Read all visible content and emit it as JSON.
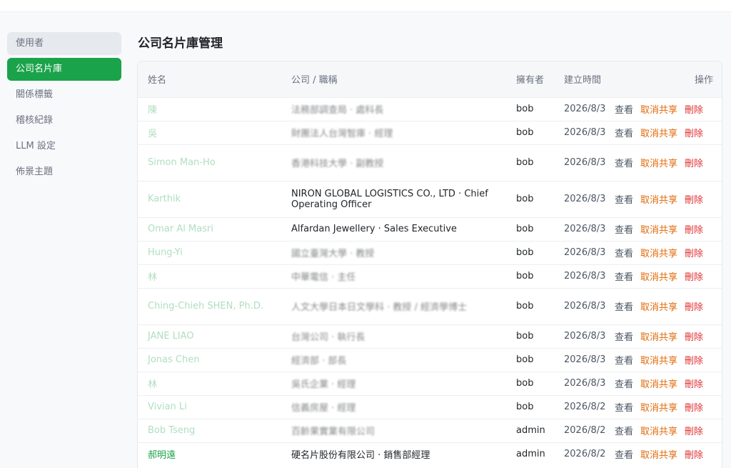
{
  "sidebar": {
    "items": [
      {
        "label": "使用者",
        "state": "hover"
      },
      {
        "label": "公司名片庫",
        "state": "active"
      },
      {
        "label": "關係標籤",
        "state": ""
      },
      {
        "label": "稽核紀錄",
        "state": ""
      },
      {
        "label": "LLM 設定",
        "state": ""
      },
      {
        "label": "佈景主題",
        "state": ""
      }
    ]
  },
  "page": {
    "title": "公司名片庫管理"
  },
  "table": {
    "headers": {
      "name": "姓名",
      "company": "公司 / 職稱",
      "owner": "擁有者",
      "created": "建立時間",
      "actions": "操作"
    },
    "actions": {
      "view": "查看",
      "unshare": "取消共享",
      "delete": "刪除"
    },
    "rows": [
      {
        "name": "陳",
        "company": "法務部調查局 · 處科長",
        "owner": "bob",
        "created": "2026/8/3"
      },
      {
        "name": "吳",
        "company": "財團法人台灣智庫 · 經理",
        "owner": "bob",
        "created": "2026/8/3"
      },
      {
        "name": "Simon Man-Ho",
        "company": "香港科技大學 · 副教授",
        "owner": "bob",
        "created": "2026/8/3"
      },
      {
        "name": "Karthik",
        "company": "NIRON GLOBAL LOGISTICS CO., LTD · Chief Operating Officer",
        "owner": "bob",
        "created": "2026/8/3"
      },
      {
        "name": "Omar Al Masri",
        "company": "Alfardan Jewellery · Sales Executive",
        "owner": "bob",
        "created": "2026/8/3"
      },
      {
        "name": "Hung-Yi",
        "company": "國立臺灣大學 · 教授",
        "owner": "bob",
        "created": "2026/8/3"
      },
      {
        "name": "林",
        "company": "中華電信 · 主任",
        "owner": "bob",
        "created": "2026/8/3"
      },
      {
        "name": "Ching-Chieh SHEN, Ph.D.",
        "company": "人文大學日本日文學科 · 教授 / 經濟學博士",
        "owner": "bob",
        "created": "2026/8/3"
      },
      {
        "name": "JANE LIAO",
        "company": "台灣公司 · 執行長",
        "owner": "bob",
        "created": "2026/8/3"
      },
      {
        "name": "Jonas Chen",
        "company": "經濟部 · 部長",
        "owner": "bob",
        "created": "2026/8/3"
      },
      {
        "name": "林",
        "company": "吳氏企業 · 經理",
        "owner": "bob",
        "created": "2026/8/3"
      },
      {
        "name": "Vivian Li",
        "company": "信義房屋 · 經理",
        "owner": "bob",
        "created": "2026/8/2"
      },
      {
        "name": "Bob Tseng",
        "company": "百齡果實業有限公司",
        "owner": "admin",
        "created": "2026/8/2"
      },
      {
        "name": "郝明遠",
        "company": "硬名片股份有限公司 · 銷售部經理",
        "owner": "admin",
        "created": "2026/8/2"
      }
    ]
  }
}
